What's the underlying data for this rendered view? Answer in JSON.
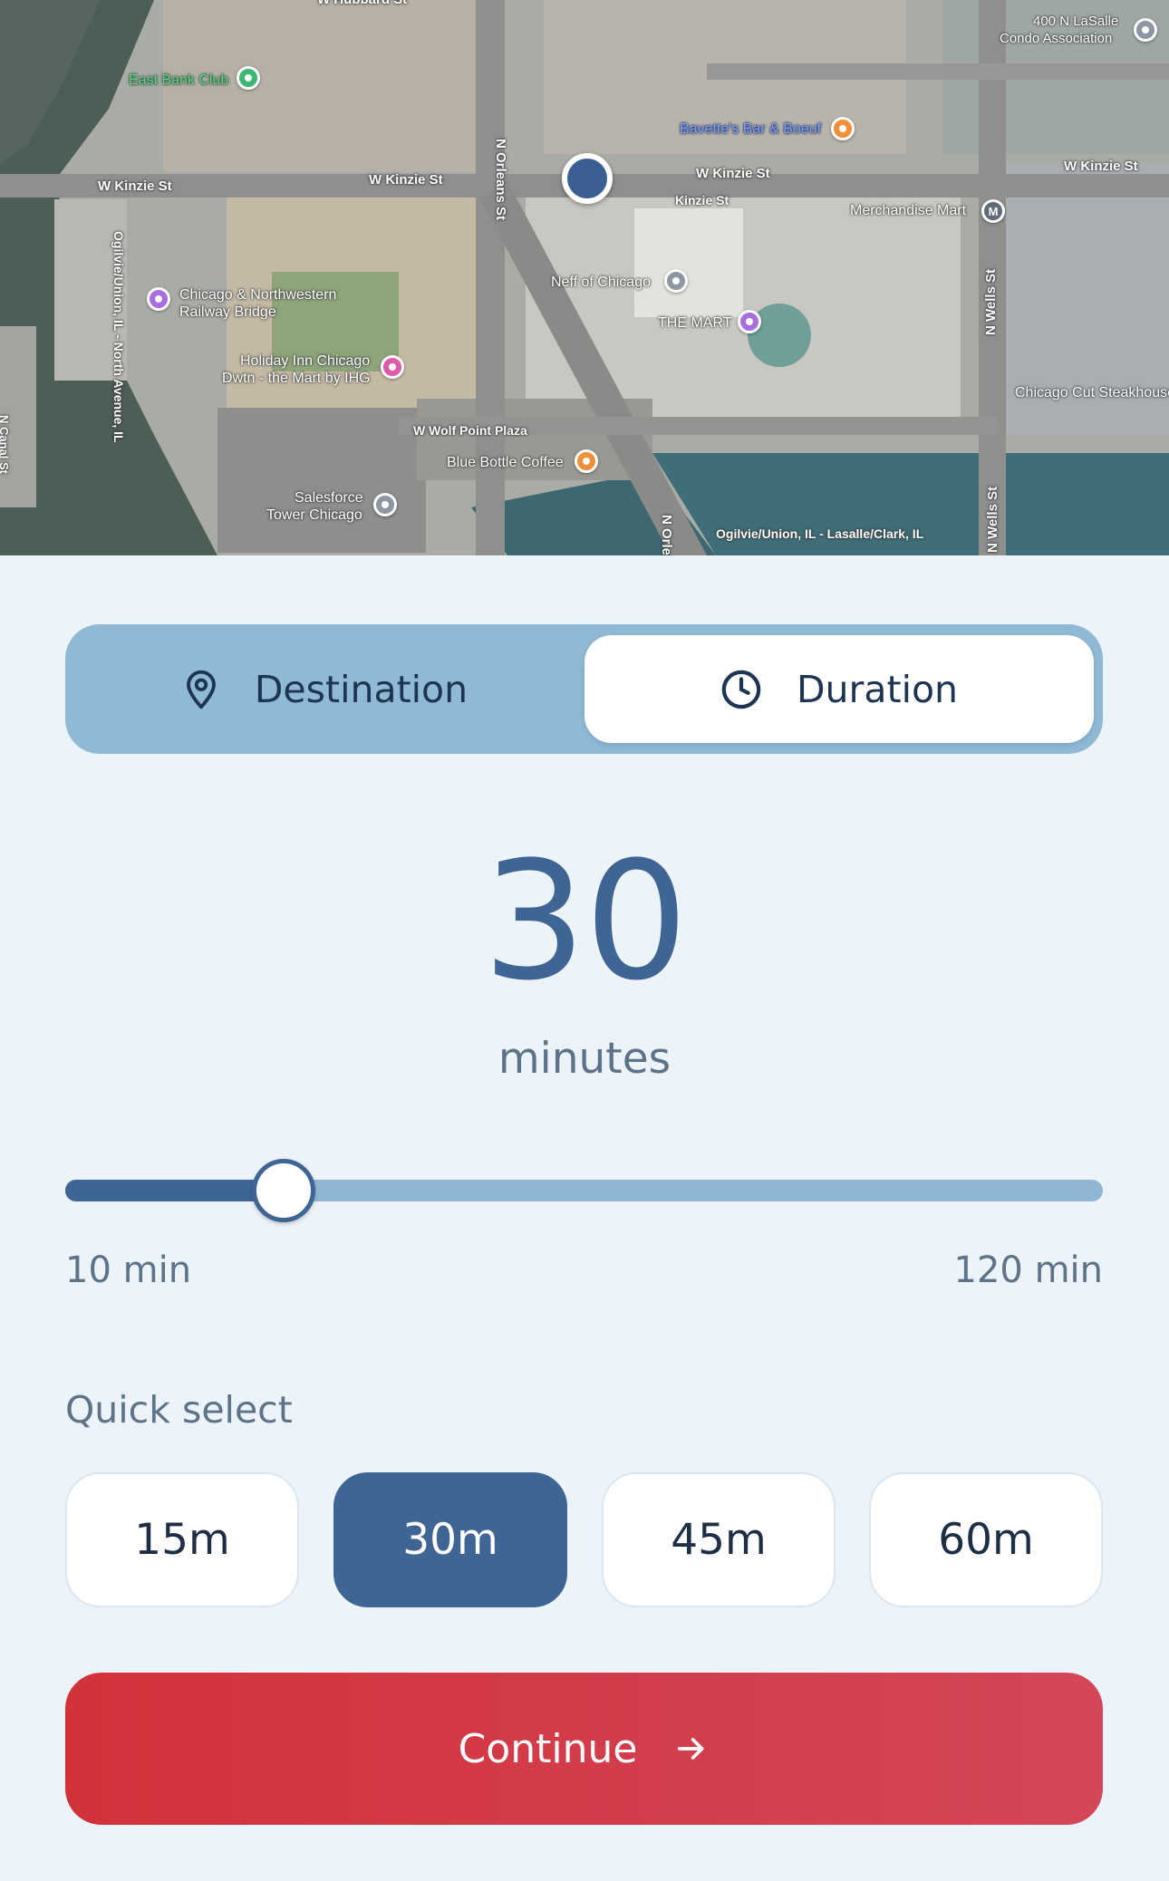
{
  "map": {
    "places": [
      {
        "name": "East Bank Club",
        "kind": "green"
      },
      {
        "name": "Bavette's Bar & Boeuf",
        "kind": "orange"
      },
      {
        "name": "400 N LaSalle Condo Association",
        "kind": "gray"
      },
      {
        "name": "Merchandise Mart",
        "kind": "metro",
        "glyph": "M"
      },
      {
        "name": "Neff of Chicago",
        "kind": "gray"
      },
      {
        "name": "THE MART",
        "kind": "purple"
      },
      {
        "name": "Chicago & Northwestern Railway Bridge",
        "kind": "purple"
      },
      {
        "name": "Holiday Inn Chicago Dwtn - the Mart by IHG",
        "kind": "pink"
      },
      {
        "name": "Blue Bottle Coffee",
        "kind": "orange"
      },
      {
        "name": "Salesforce Tower Chicago",
        "kind": "gray"
      }
    ],
    "labels": {
      "w_hubbard_st": "W Hubbard St",
      "w_kinzie_st": "W Kinzie St",
      "kinzie_st": "Kinzie St",
      "n_orleans_st": "N Orleans St",
      "n_orleans_st_2": "N Orle",
      "n_wells_st": "N Wells St",
      "w_wolf_point_plaza": "W Wolf Point Plaza",
      "ogilvie_north_avenue": "Ogilvie/Union, IL - North Avenue, IL",
      "ogilvie_lasalle": "Ogilvie/Union, IL - Lasalle/Clark, IL",
      "chicago_cut": "Chicago Cut Steakhouse",
      "n_canal_st": "N Canal St",
      "east_bank_club": "East Bank Club",
      "bavettes": "Bavette's Bar & Boeuf",
      "lasalle_condo_1": "400 N LaSalle",
      "lasalle_condo_2": "Condo Association",
      "merchandise_mart": "Merchandise Mart",
      "neff": "Neff of Chicago",
      "the_mart": "THE MART",
      "rail_bridge_1": "Chicago & Northwestern",
      "rail_bridge_2": "Railway Bridge",
      "holiday_inn_1": "Holiday Inn Chicago",
      "holiday_inn_2": "Dwtn - the Mart by IHG",
      "blue_bottle": "Blue Bottle Coffee",
      "salesforce_1": "Salesforce",
      "salesforce_2": "Tower Chicago"
    },
    "colors": {
      "green": "#3cb873",
      "orange": "#f0903a",
      "gray": "#8d97a3",
      "purple": "#a86ee0",
      "pink": "#e05aa8",
      "metro": "#5f6b78"
    }
  },
  "mode_toggle": {
    "destination_label": "Destination",
    "duration_label": "Duration",
    "selected": "duration",
    "destination_icon": "map-pin-icon",
    "duration_icon": "clock-icon"
  },
  "duration": {
    "value": "30",
    "unit": "minutes",
    "min_value": 10,
    "max_value": 120,
    "current_value": 30,
    "min_label": "10 min",
    "max_label": "120 min"
  },
  "quick_select": {
    "label": "Quick select",
    "options": [
      "15m",
      "30m",
      "45m",
      "60m"
    ],
    "selected": "30m"
  },
  "continue_button": {
    "label": "Continue",
    "icon": "arrow-right-icon"
  },
  "theme": {
    "accent": "#3f6594",
    "background": "#ecf3f9",
    "cta_start": "#d2323a",
    "cta_end": "#d44659"
  }
}
